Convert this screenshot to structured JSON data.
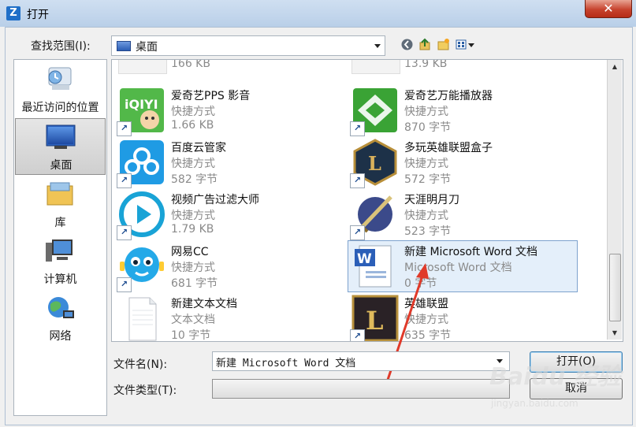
{
  "window": {
    "title": "打开",
    "close_glyph": "✕"
  },
  "lookin": {
    "label": "查找范围(I):",
    "value": "桌面"
  },
  "toolbar": {
    "icons": [
      "back-icon",
      "up-folder-icon",
      "new-folder-icon",
      "view-menu-icon"
    ]
  },
  "places": [
    {
      "label": "最近访问的位置",
      "icon": "recent-places-icon",
      "selected": false
    },
    {
      "label": "桌面",
      "icon": "desktop-icon",
      "selected": true
    },
    {
      "label": "库",
      "icon": "libraries-icon",
      "selected": false
    },
    {
      "label": "计算机",
      "icon": "computer-icon",
      "selected": false
    },
    {
      "label": "网络",
      "icon": "network-icon",
      "selected": false
    }
  ],
  "files": {
    "partial_top": [
      {
        "size": "166 KB"
      },
      {
        "size": "13.9 KB"
      }
    ],
    "items": [
      {
        "name": "爱奇艺PPS 影音",
        "type": "快捷方式",
        "size": "1.66 KB",
        "icon": "iqiyi-pps-icon",
        "shortcut": true
      },
      {
        "name": "爱奇艺万能播放器",
        "type": "快捷方式",
        "size": "870 字节",
        "icon": "iqiyi-player-icon",
        "shortcut": true
      },
      {
        "name": "百度云管家",
        "type": "快捷方式",
        "size": "582 字节",
        "icon": "baidu-cloud-icon",
        "shortcut": true
      },
      {
        "name": "多玩英雄联盟盒子",
        "type": "快捷方式",
        "size": "572 字节",
        "icon": "lol-box-icon",
        "shortcut": true
      },
      {
        "name": "视频广告过滤大师",
        "type": "快捷方式",
        "size": "1.79 KB",
        "icon": "ad-filter-icon",
        "shortcut": true
      },
      {
        "name": "天涯明月刀",
        "type": "快捷方式",
        "size": "523 字节",
        "icon": "tianya-icon",
        "shortcut": true
      },
      {
        "name": "网易CC",
        "type": "快捷方式",
        "size": "681 字节",
        "icon": "netease-cc-icon",
        "shortcut": true
      },
      {
        "name": "新建 Microsoft Word 文档",
        "type": "Microsoft Word 文档",
        "size": "0 字节",
        "icon": "word-document-icon",
        "shortcut": false,
        "selected": true
      },
      {
        "name": "新建文本文档",
        "type": "文本文档",
        "size": "10 字节",
        "icon": "text-document-icon",
        "shortcut": false
      },
      {
        "name": "英雄联盟",
        "type": "快捷方式",
        "size": "635 字节",
        "icon": "lol-icon",
        "shortcut": true
      }
    ]
  },
  "filename": {
    "label": "文件名(N):",
    "value": "新建 Microsoft Word 文档"
  },
  "filetype": {
    "label": "文件类型(T):",
    "value": ""
  },
  "buttons": {
    "open": "打开(O)",
    "cancel": "取消"
  },
  "watermark": {
    "brand": "Baidu 经验",
    "url": "jingyan.baidu.com"
  },
  "colors": {
    "title_bar": "#b9cfe8",
    "close_button": "#c7432e",
    "selection": "#e4effa",
    "annotation_arrow": "#e03a2a"
  }
}
